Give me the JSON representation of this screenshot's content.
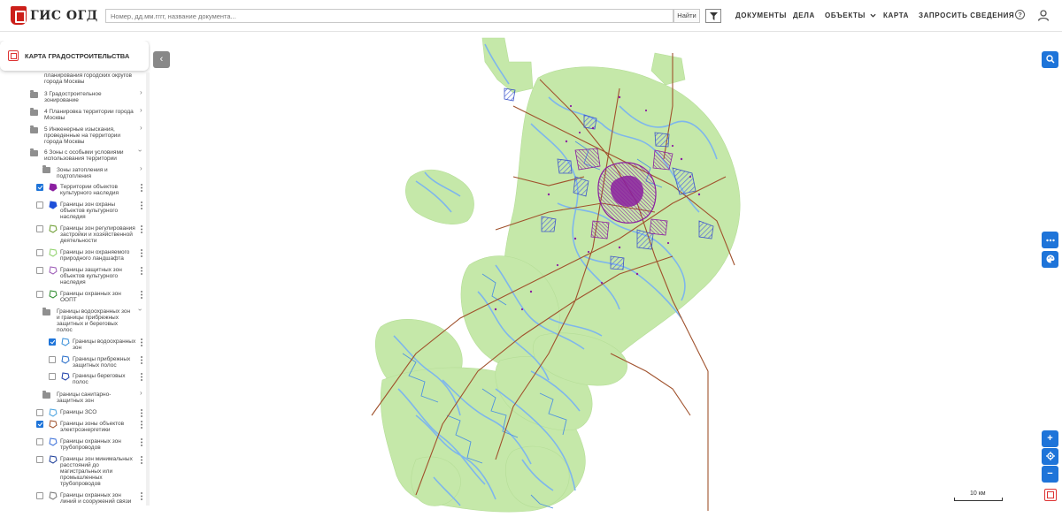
{
  "header": {
    "logo_text": "ГИС ОГД",
    "search_placeholder": "Номер, дд.мм.гггг, название документа...",
    "find_label": "Найти",
    "nav": [
      "ДОКУМЕНТЫ",
      "ДЕЛА",
      "ОБЪЕКТЫ",
      "КАРТА",
      "ЗАПРОСИТЬ СВЕДЕНИЯ"
    ],
    "help_glyph": "?"
  },
  "panel": {
    "title": "КАРТА ГРАДОСТРОИТЕЛЬСТВА",
    "items": [
      {
        "text": "планирования городских округов города Москвы",
        "kind": "text"
      },
      {
        "text": "3 Градостроительное зонирование",
        "kind": "folder"
      },
      {
        "text": "4 Планировка территории города Москвы",
        "kind": "folder"
      },
      {
        "text": "5 Инженерные изыскания, проведенные на территории города Москвы",
        "kind": "folder"
      },
      {
        "text": "6 Зоны с особыми условиями использования территории",
        "kind": "folder-open"
      },
      {
        "text": "Зоны затопления и подтопления",
        "kind": "subfolder"
      },
      {
        "text": "Территории объектов культурного наследия",
        "kind": "layer",
        "checked": true,
        "color": "#8b1fa0",
        "filled": true
      },
      {
        "text": "Границы зон охраны объектов культурного наследия",
        "kind": "layer",
        "checked": false,
        "color": "#1e4fd9",
        "filled": true
      },
      {
        "text": "Границы зон регулирования застройки и хозяйственной деятельности",
        "kind": "layer",
        "checked": false,
        "color": "#6a9b2e",
        "filled": false
      },
      {
        "text": "Границы зон охраняемого природного ландшафта",
        "kind": "layer",
        "checked": false,
        "color": "#8fd16a",
        "filled": false
      },
      {
        "text": "Границы защитных зон объектов культурного наследия",
        "kind": "layer",
        "checked": false,
        "color": "#9b59b6",
        "filled": false
      },
      {
        "text": "Границы охранных зон ООПТ",
        "kind": "layer",
        "checked": false,
        "color": "#2e8b2e",
        "filled": false
      },
      {
        "text": "Границы водоохранных зон и границы прибрежных защитных и береговых полос",
        "kind": "subfolder-open"
      },
      {
        "text": "Границы водоохранных зон",
        "kind": "sublayer",
        "checked": true,
        "color": "#3a8fd9",
        "filled": false
      },
      {
        "text": "Границы прибрежных защитных полос",
        "kind": "sublayer",
        "checked": false,
        "color": "#2a6fc9",
        "filled": false
      },
      {
        "text": "Границы береговых полос",
        "kind": "sublayer",
        "checked": false,
        "color": "#1e3fa9",
        "filled": false
      },
      {
        "text": "Границы санитарно-защитных зон",
        "kind": "subfolder"
      },
      {
        "text": "Границы ЗСО",
        "kind": "layer",
        "checked": false,
        "color": "#4aa3df",
        "filled": false
      },
      {
        "text": "Границы зоны объектов электроэнергетики",
        "kind": "layer",
        "checked": true,
        "color": "#a0522d",
        "filled": false
      },
      {
        "text": "Границы охранных зон трубопроводов",
        "kind": "layer",
        "checked": false,
        "color": "#3a6fd9",
        "filled": false
      },
      {
        "text": "Границы зон минимальных расстояний до магистральных или промышленных трубопроводов",
        "kind": "layer",
        "checked": false,
        "color": "#1e3f9a",
        "filled": false
      },
      {
        "text": "Границы охранных зон линий и сооружений связи",
        "kind": "layer",
        "checked": false,
        "color": "#777777",
        "filled": false
      }
    ]
  },
  "map": {
    "scale_label": "10 км",
    "colors": {
      "green": "#c5e8a9",
      "water": "#7eb6ec",
      "power": "#a0522d",
      "heritage": "#8b1fa0",
      "accent": "#1e74d9"
    }
  },
  "controls": {
    "search_icon": "search-icon",
    "more_icon": "more-icon",
    "palette_icon": "palette-icon",
    "zoom_in": "+",
    "locate_icon": "locate-icon",
    "zoom_out": "−"
  }
}
